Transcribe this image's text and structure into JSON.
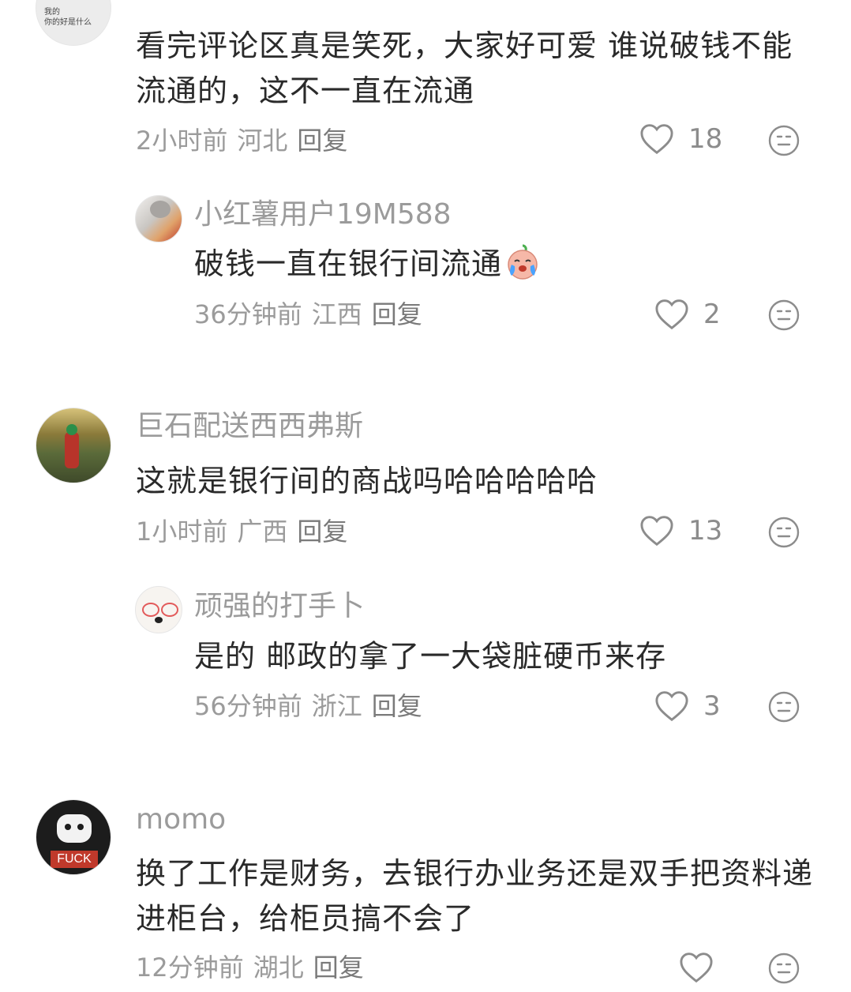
{
  "comments": [
    {
      "text": "看完评论区真是笑死，大家好可爱 谁说破钱不能流通的，这不一直在流通",
      "time": "2小时前",
      "location": "河北",
      "reply": "回复",
      "likes": "18",
      "avatar_text": "我的\n你的好是什么",
      "replies": [
        {
          "username": "小红薯用户19M588",
          "text": "破钱一直在银行间流通",
          "emoji": "crying-face-emoji",
          "time": "36分钟前",
          "location": "江西",
          "reply": "回复",
          "likes": "2"
        }
      ]
    },
    {
      "username": "巨石配送西西弗斯",
      "text": "这就是银行间的商战吗哈哈哈哈哈",
      "time": "1小时前",
      "location": "广西",
      "reply": "回复",
      "likes": "13",
      "replies": [
        {
          "username": "顽强的打手卜",
          "text": "是的 邮政的拿了一大袋脏硬币来存",
          "time": "56分钟前",
          "location": "浙江",
          "reply": "回复",
          "likes": "3"
        }
      ]
    },
    {
      "username": "momo",
      "text": "换了工作是财务，去银行办业务还是双手把资料递进柜台，给柜员搞不会了",
      "time": "12分钟前",
      "location": "湖北",
      "reply": "回复",
      "likes": "",
      "avatar_text": "FUCK"
    }
  ],
  "icons": {
    "like": "heart-outline-icon",
    "dislike": "neutral-face-icon"
  },
  "colors": {
    "meta": "#9b9b9b",
    "text": "#2a2a2a",
    "icon": "#8c8c8c"
  }
}
